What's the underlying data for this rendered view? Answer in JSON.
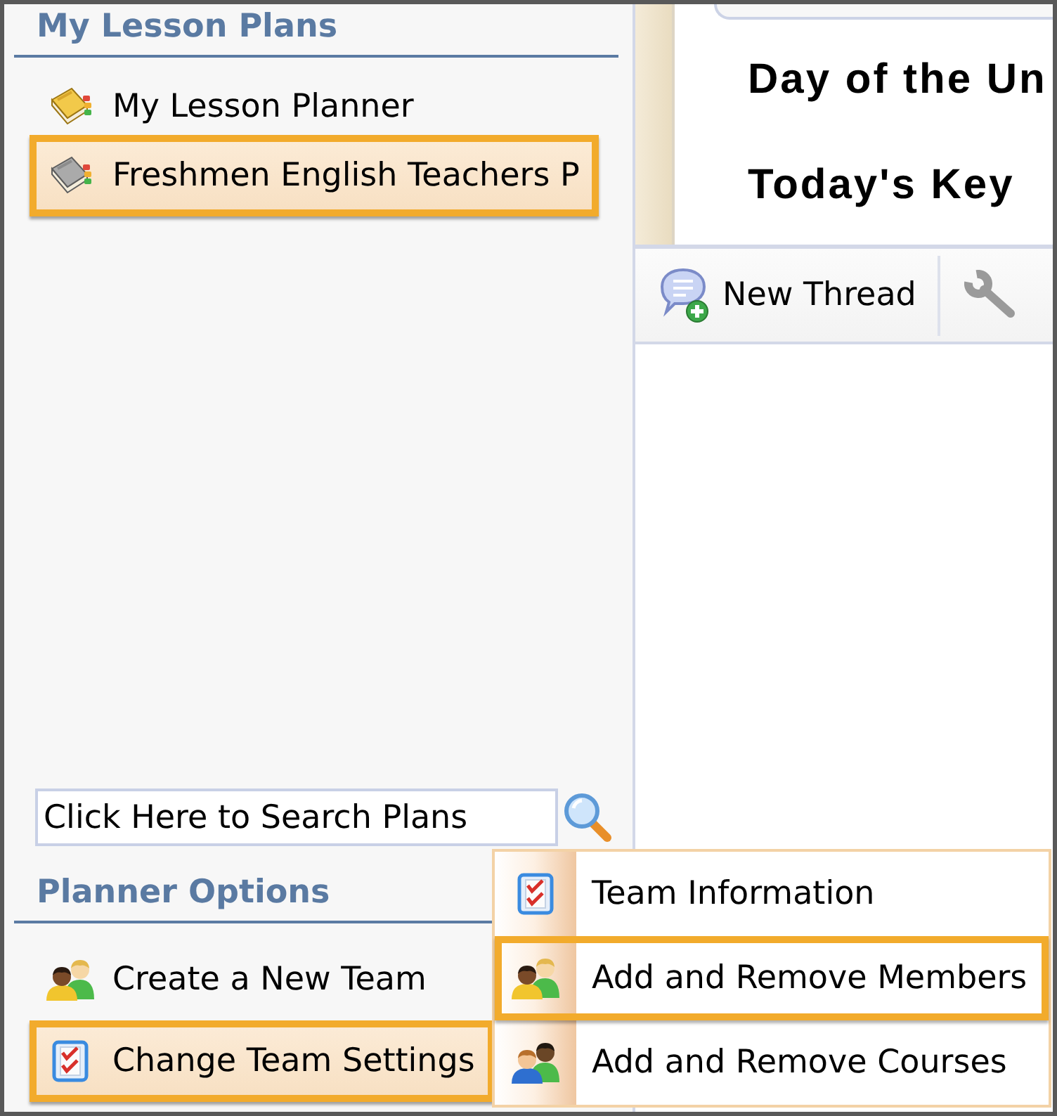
{
  "sidebar": {
    "lesson_plans": {
      "title": "My Lesson Plans",
      "items": [
        {
          "label": "My Lesson Planner",
          "kind": "personal",
          "selected": false
        },
        {
          "label": "Freshmen English Teachers P",
          "kind": "team",
          "selected": true
        }
      ]
    },
    "search": {
      "placeholder": "Click Here to Search Plans"
    },
    "planner_options": {
      "title": "Planner Options",
      "items": [
        {
          "label": "Create a New Team",
          "kind": "new-team",
          "selected": false
        },
        {
          "label": "Change Team Settings",
          "kind": "settings",
          "selected": true,
          "submenu": [
            {
              "label": "Team Information",
              "kind": "info",
              "selected": false
            },
            {
              "label": "Add and Remove Members",
              "kind": "members",
              "selected": true
            },
            {
              "label": "Add and Remove Courses",
              "kind": "courses",
              "selected": false
            }
          ]
        }
      ]
    }
  },
  "content": {
    "headings": [
      "Day of the Un",
      "Today's Key"
    ],
    "toolbar": {
      "new_thread_button": "New Thread"
    }
  }
}
